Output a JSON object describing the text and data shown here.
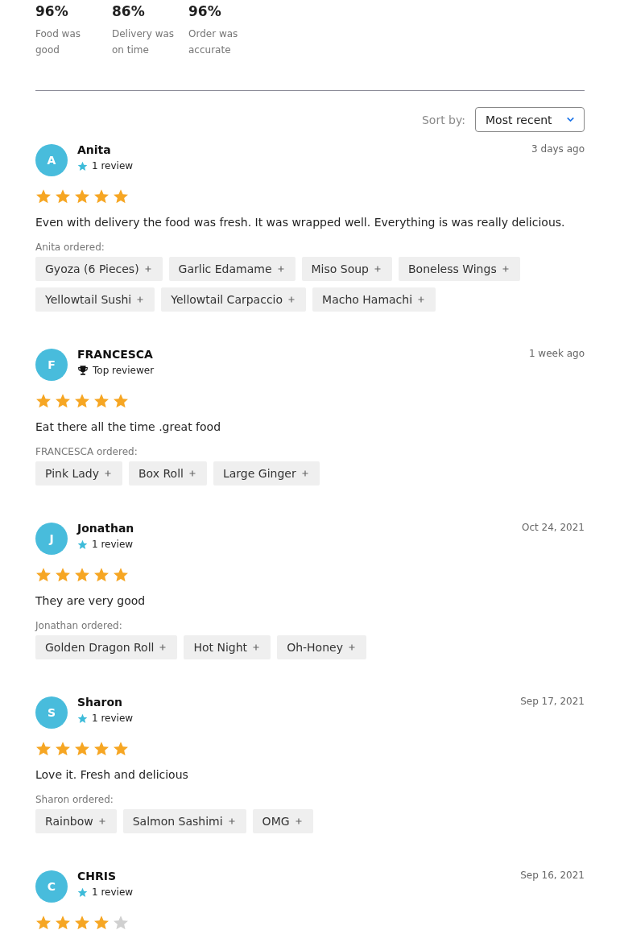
{
  "ratings": [
    {
      "percent": "96%",
      "label": "Food was good"
    },
    {
      "percent": "86%",
      "label": "Delivery was on time"
    },
    {
      "percent": "96%",
      "label": "Order was accurate"
    }
  ],
  "sort": {
    "label": "Sort by:",
    "value": "Most recent"
  },
  "reviews": [
    {
      "initial": "A",
      "name": "Anita",
      "badge": {
        "kind": "review_count",
        "text": "1 review"
      },
      "date": "3 days ago",
      "stars": 5,
      "text": "Even with delivery the food was fresh. It was wrapped well. Everything is was really delicious.",
      "ordered_label": "Anita ordered:",
      "items": [
        "Gyoza (6 Pieces)",
        "Garlic Edamame",
        "Miso Soup",
        "Boneless Wings",
        "Yellowtail Sushi",
        "Yellowtail Carpaccio",
        "Macho Hamachi"
      ]
    },
    {
      "initial": "F",
      "name": "FRANCESCA",
      "badge": {
        "kind": "top_reviewer",
        "text": "Top reviewer"
      },
      "date": "1 week ago",
      "stars": 5,
      "text": "Eat there all the time .great food",
      "ordered_label": "FRANCESCA ordered:",
      "items": [
        "Pink Lady",
        "Box Roll",
        "Large Ginger"
      ]
    },
    {
      "initial": "J",
      "name": "Jonathan",
      "badge": {
        "kind": "review_count",
        "text": "1 review"
      },
      "date": "Oct 24, 2021",
      "stars": 5,
      "text": "They are very good",
      "ordered_label": "Jonathan ordered:",
      "items": [
        "Golden Dragon Roll",
        "Hot Night",
        "Oh-Honey"
      ]
    },
    {
      "initial": "S",
      "name": "Sharon",
      "badge": {
        "kind": "review_count",
        "text": "1 review"
      },
      "date": "Sep 17, 2021",
      "stars": 5,
      "text": "Love it. Fresh and delicious",
      "ordered_label": "Sharon ordered:",
      "items": [
        "Rainbow",
        "Salmon Sashimi",
        "OMG"
      ]
    },
    {
      "initial": "C",
      "name": "CHRIS",
      "badge": {
        "kind": "review_count",
        "text": "1 review"
      },
      "date": "Sep 16, 2021",
      "stars": 4
    }
  ]
}
